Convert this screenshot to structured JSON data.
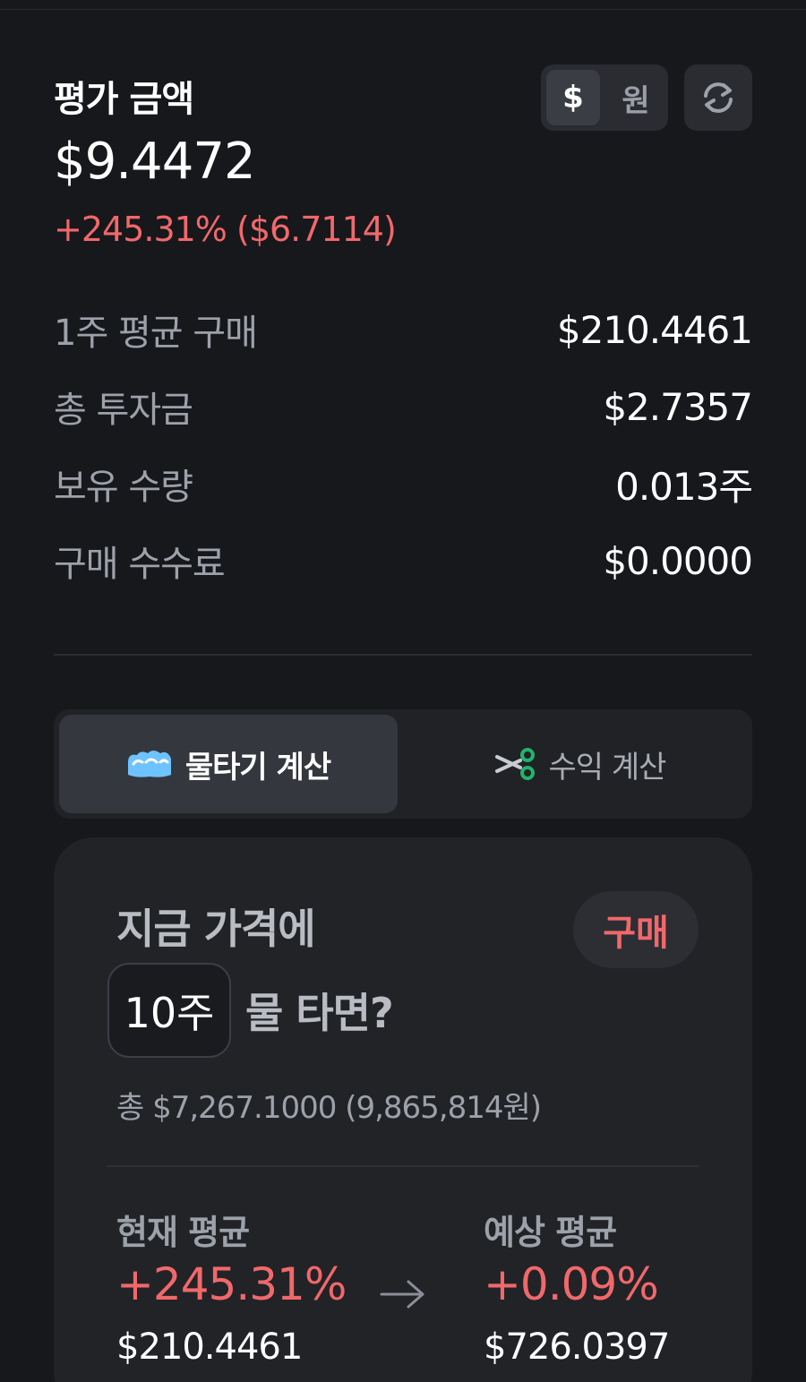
{
  "summary": {
    "title": "평가 금액",
    "amount": "$9.4472",
    "change": "+245.31% ($6.7114)"
  },
  "currency_toggle": {
    "usd_label": "$",
    "krw_label": "원",
    "selected": "$"
  },
  "stats": [
    {
      "label": "1주 평균 구매",
      "value": "$210.4461"
    },
    {
      "label": "총 투자금",
      "value": "$2.7357"
    },
    {
      "label": "보유 수량",
      "value": "0.013주"
    },
    {
      "label": "구매 수수료",
      "value": "$0.0000"
    }
  ],
  "tabs": {
    "water": {
      "label": "물타기 계산",
      "icon": "wave-icon",
      "active": true
    },
    "profit": {
      "label": "수익 계산",
      "icon": "scissors-icon",
      "active": false
    }
  },
  "calc": {
    "question_line1": "지금 가격에",
    "qty": "10주",
    "question_line2": "물 타면?",
    "buy_label": "구매",
    "total": "총 $7,267.1000 (9,865,814원)",
    "current": {
      "label": "현재 평균",
      "pct": "+245.31%",
      "price": "$210.4461"
    },
    "expected": {
      "label": "예상 평균",
      "pct": "+0.09%",
      "price": "$726.0397"
    }
  },
  "colors": {
    "background": "#17181c",
    "card": "#212327",
    "accent_red": "#f1686b",
    "muted_text": "#9da1a9"
  }
}
